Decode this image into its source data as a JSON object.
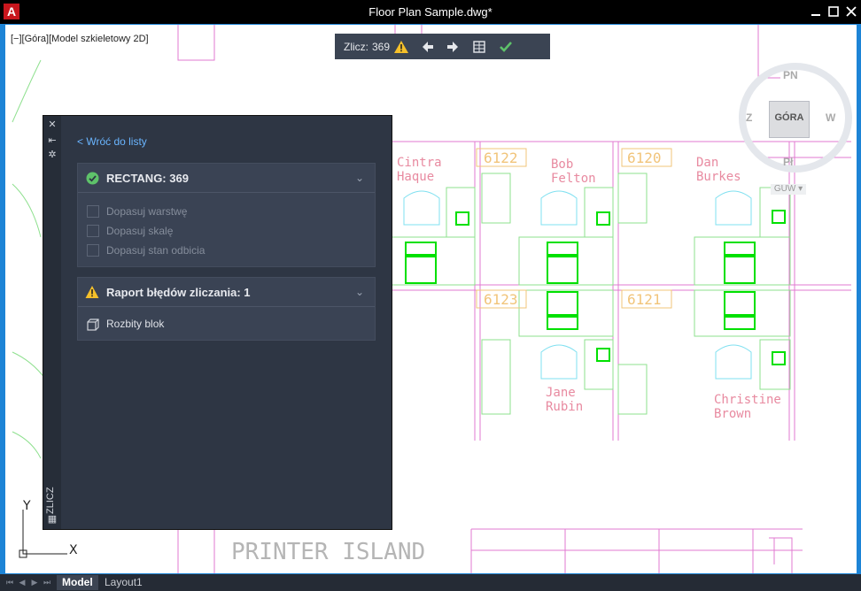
{
  "titlebar": {
    "app_icon": "A",
    "title": "Floor Plan Sample.dwg*",
    "minimize_icon": "minimize-icon",
    "maximize_icon": "maximize-icon",
    "close_icon": "close-icon"
  },
  "viewport": {
    "label": "[−][Góra][Model szkieletowy 2D]"
  },
  "count_toolbar": {
    "label": "Zlicz:",
    "count": "369",
    "icons": [
      "warning-icon",
      "arrow-left-icon",
      "arrow-right-icon",
      "insert-table-icon",
      "checkmark-icon"
    ]
  },
  "viewcube": {
    "north": "PN",
    "south": "Pł",
    "west": "Z",
    "east": "W",
    "face": "GÓRA",
    "ucs": "GUW"
  },
  "floorplan": {
    "rooms": [
      "6122",
      "6120",
      "6123",
      "6121"
    ],
    "names": [
      [
        "Cintra",
        "Haque"
      ],
      [
        "Bob",
        "Felton"
      ],
      [
        "Dan",
        "Burkes"
      ],
      [
        "Jane",
        "Rubin"
      ],
      [
        "Christine",
        "Brown"
      ]
    ],
    "printer_island": "PRINTER ISLAND",
    "ucs_y": "Y",
    "ucs_x": "X"
  },
  "count_panel": {
    "strip_label": "ZLICZ",
    "back_link": "< Wróć do listy",
    "block_card": {
      "title": "RECTANG: 369",
      "options": [
        "Dopasuj warstwę",
        "Dopasuj skalę",
        "Dopasuj stan odbicia"
      ]
    },
    "error_card": {
      "title": "Raport błędów zliczania: 1",
      "items": [
        "Rozbity blok"
      ]
    }
  },
  "statusbar": {
    "tabs": [
      "Model",
      "Layout1"
    ]
  },
  "colors": {
    "frame": "#1d84d6",
    "panel": "#2e3644",
    "card": "#3a4354",
    "accent_link": "#6ab5ff",
    "success": "#5ec26a",
    "warning": "#f5c02a",
    "wall_magenta": "#e27ad0",
    "furniture_cyan": "#7fe0f0",
    "block_green": "#00e000",
    "room_tag": "#f1c47a",
    "name_text": "#e88aa0"
  }
}
